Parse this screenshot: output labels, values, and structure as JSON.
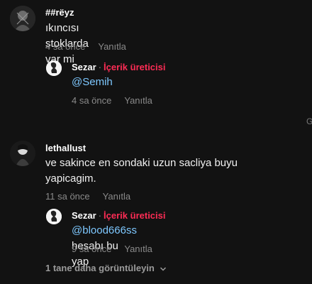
{
  "comments": [
    {
      "username": "##rëyz",
      "text": "ıkıncısı stoklarda var mi",
      "time": "4 sa önce",
      "reply_label": "Yanıtla",
      "replies": [
        {
          "username": "Sezar",
          "separator": "·",
          "badge": "İçerik üreticisi",
          "mention": "@Semih",
          "text": "",
          "time": "4 sa önce",
          "reply_label": "Yanıtla"
        }
      ]
    },
    {
      "username": "lethallust",
      "text": "ve sakince en sondaki uzun sacliya buyu yapicagim.",
      "time": "11 sa önce",
      "reply_label": "Yanıtla",
      "replies": [
        {
          "username": "Sezar",
          "separator": "·",
          "badge": "İçerik üreticisi",
          "mention": "@blood666ss",
          "text": " hesabı bu yap",
          "time": "9 sa önce",
          "reply_label": "Yanıtla"
        }
      ]
    }
  ],
  "more_replies_label": "1 tane daha görüntüleyin",
  "more_replies_icon": "chevron-down-icon",
  "edge_text": "G"
}
